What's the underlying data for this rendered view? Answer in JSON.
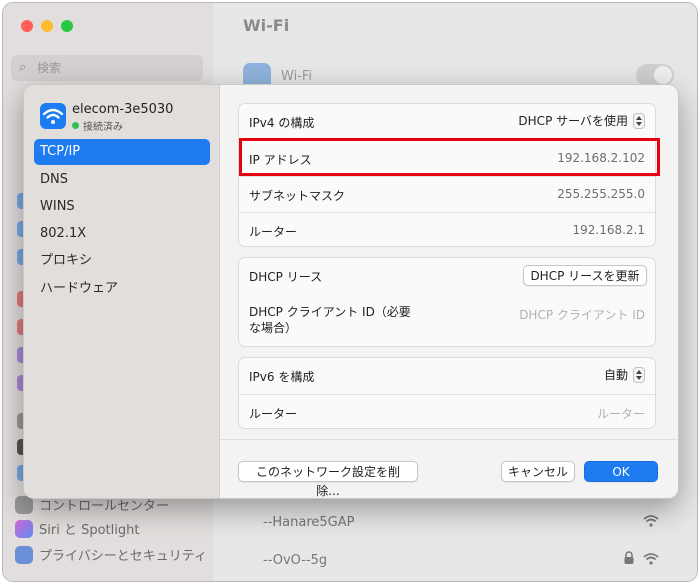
{
  "background": {
    "window_title": "Wi-Fi",
    "search_placeholder": "検索",
    "wifi_label": "Wi-Fi",
    "sidebar_items": [
      "コントロールセンター",
      "Siri と Spotlight",
      "プライバシーとセキュリティ"
    ],
    "networks": [
      {
        "name": "--Hanare5GAP",
        "locked": false
      },
      {
        "name": "--OvO--5g",
        "locked": true
      }
    ]
  },
  "dialog": {
    "network": {
      "name": "elecom-3e5030",
      "status": "接続済み"
    },
    "nav": [
      "TCP/IP",
      "DNS",
      "WINS",
      "802.1X",
      "プロキシ",
      "ハードウェア"
    ],
    "active_nav": "TCP/IP",
    "ipv4_group": {
      "configure_label": "IPv4 の構成",
      "configure_value": "DHCP サーバを使用",
      "ip_label": "IP アドレス",
      "ip_value": "192.168.2.102",
      "subnet_label": "サブネットマスク",
      "subnet_value": "255.255.255.0",
      "router_label": "ルーター",
      "router_value": "192.168.2.1"
    },
    "dhcp_group": {
      "lease_label": "DHCP リース",
      "renew_button": "DHCP リースを更新",
      "client_id_label": "DHCP クライアント ID（必要な場合）",
      "client_id_placeholder": "DHCP クライアント ID"
    },
    "ipv6_group": {
      "configure_label": "IPv6 を構成",
      "configure_value": "自動",
      "router_label": "ルーター",
      "router_placeholder": "ルーター"
    },
    "footer": {
      "delete_button": "このネットワーク設定を削除...",
      "cancel_button": "キャンセル",
      "ok_button": "OK"
    }
  },
  "colors": {
    "accent": "#1f7bf0",
    "highlight_box": "#e60012",
    "connected": "#30c052"
  }
}
